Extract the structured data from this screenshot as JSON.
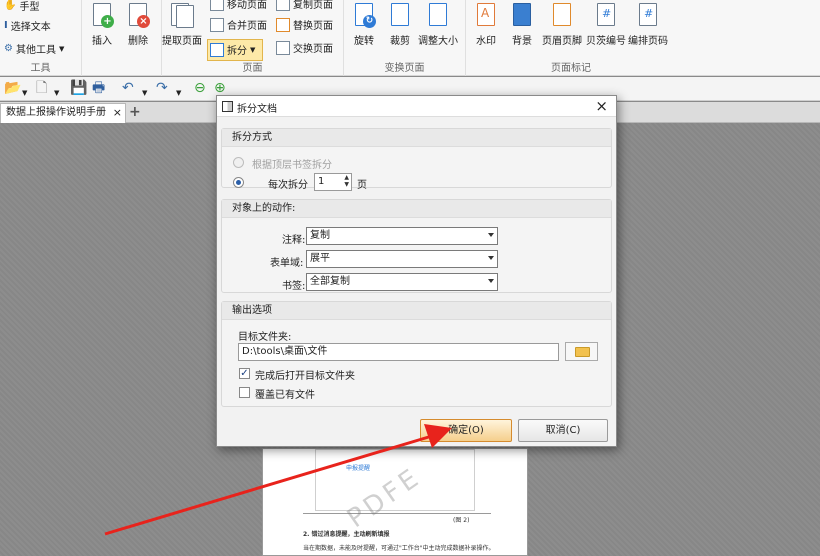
{
  "ribbon": {
    "tools_group": {
      "label": "工具",
      "hand": "手型",
      "select_text": "选择文本",
      "other_tools": "其他工具"
    },
    "insert": "插入",
    "delete": "删除",
    "pages_group": {
      "label": "页面",
      "extract": "提取页面",
      "move": "移动页面",
      "merge": "合并页面",
      "split": "拆分",
      "copy": "复制页面",
      "replace": "替换页面",
      "swap": "交换页面"
    },
    "transform_group": {
      "label": "变换页面",
      "rotate": "旋转",
      "crop": "裁剪",
      "resize": "调整大小"
    },
    "marks_group": {
      "label": "页面标记",
      "watermark": "水印",
      "background": "背景",
      "header_footer": "页眉页脚",
      "bates": "贝茨编号",
      "page_numbers": "编排页码"
    }
  },
  "tab": {
    "title": "数据上报操作说明手册",
    "close": "×",
    "add": "+"
  },
  "page_preview": {
    "watermark": "PDFE",
    "caption": "(图 2)",
    "heading": "2. 错过消息提醒，主动刷新填报",
    "body": "当在期数据，未能及时提醒，可通过\"工作台\"中主动完成数据补录操作。",
    "figure_label": "申报提醒"
  },
  "dialog": {
    "title": "拆分文档",
    "close": "×",
    "split_method": {
      "header": "拆分方式",
      "option_bookmark": "根据顶层书签拆分",
      "option_pages_prefix": "每次拆分",
      "pages_value": "1",
      "option_pages_suffix": "页"
    },
    "object_actions": {
      "header": "对象上的动作:",
      "annotation_label": "注释:",
      "annotation_value": "复制",
      "form_label": "表单域:",
      "form_value": "展平",
      "bookmark_label": "书签:",
      "bookmark_value": "全部复制"
    },
    "output": {
      "header": "输出选项",
      "target_label": "目标文件夹:",
      "target_value": "D:\\tools\\桌面\\文件",
      "open_after": "完成后打开目标文件夹",
      "open_after_checked": true,
      "overwrite": "覆盖已有文件",
      "overwrite_checked": false
    },
    "ok": "确定(O)",
    "cancel": "取消(C)"
  }
}
